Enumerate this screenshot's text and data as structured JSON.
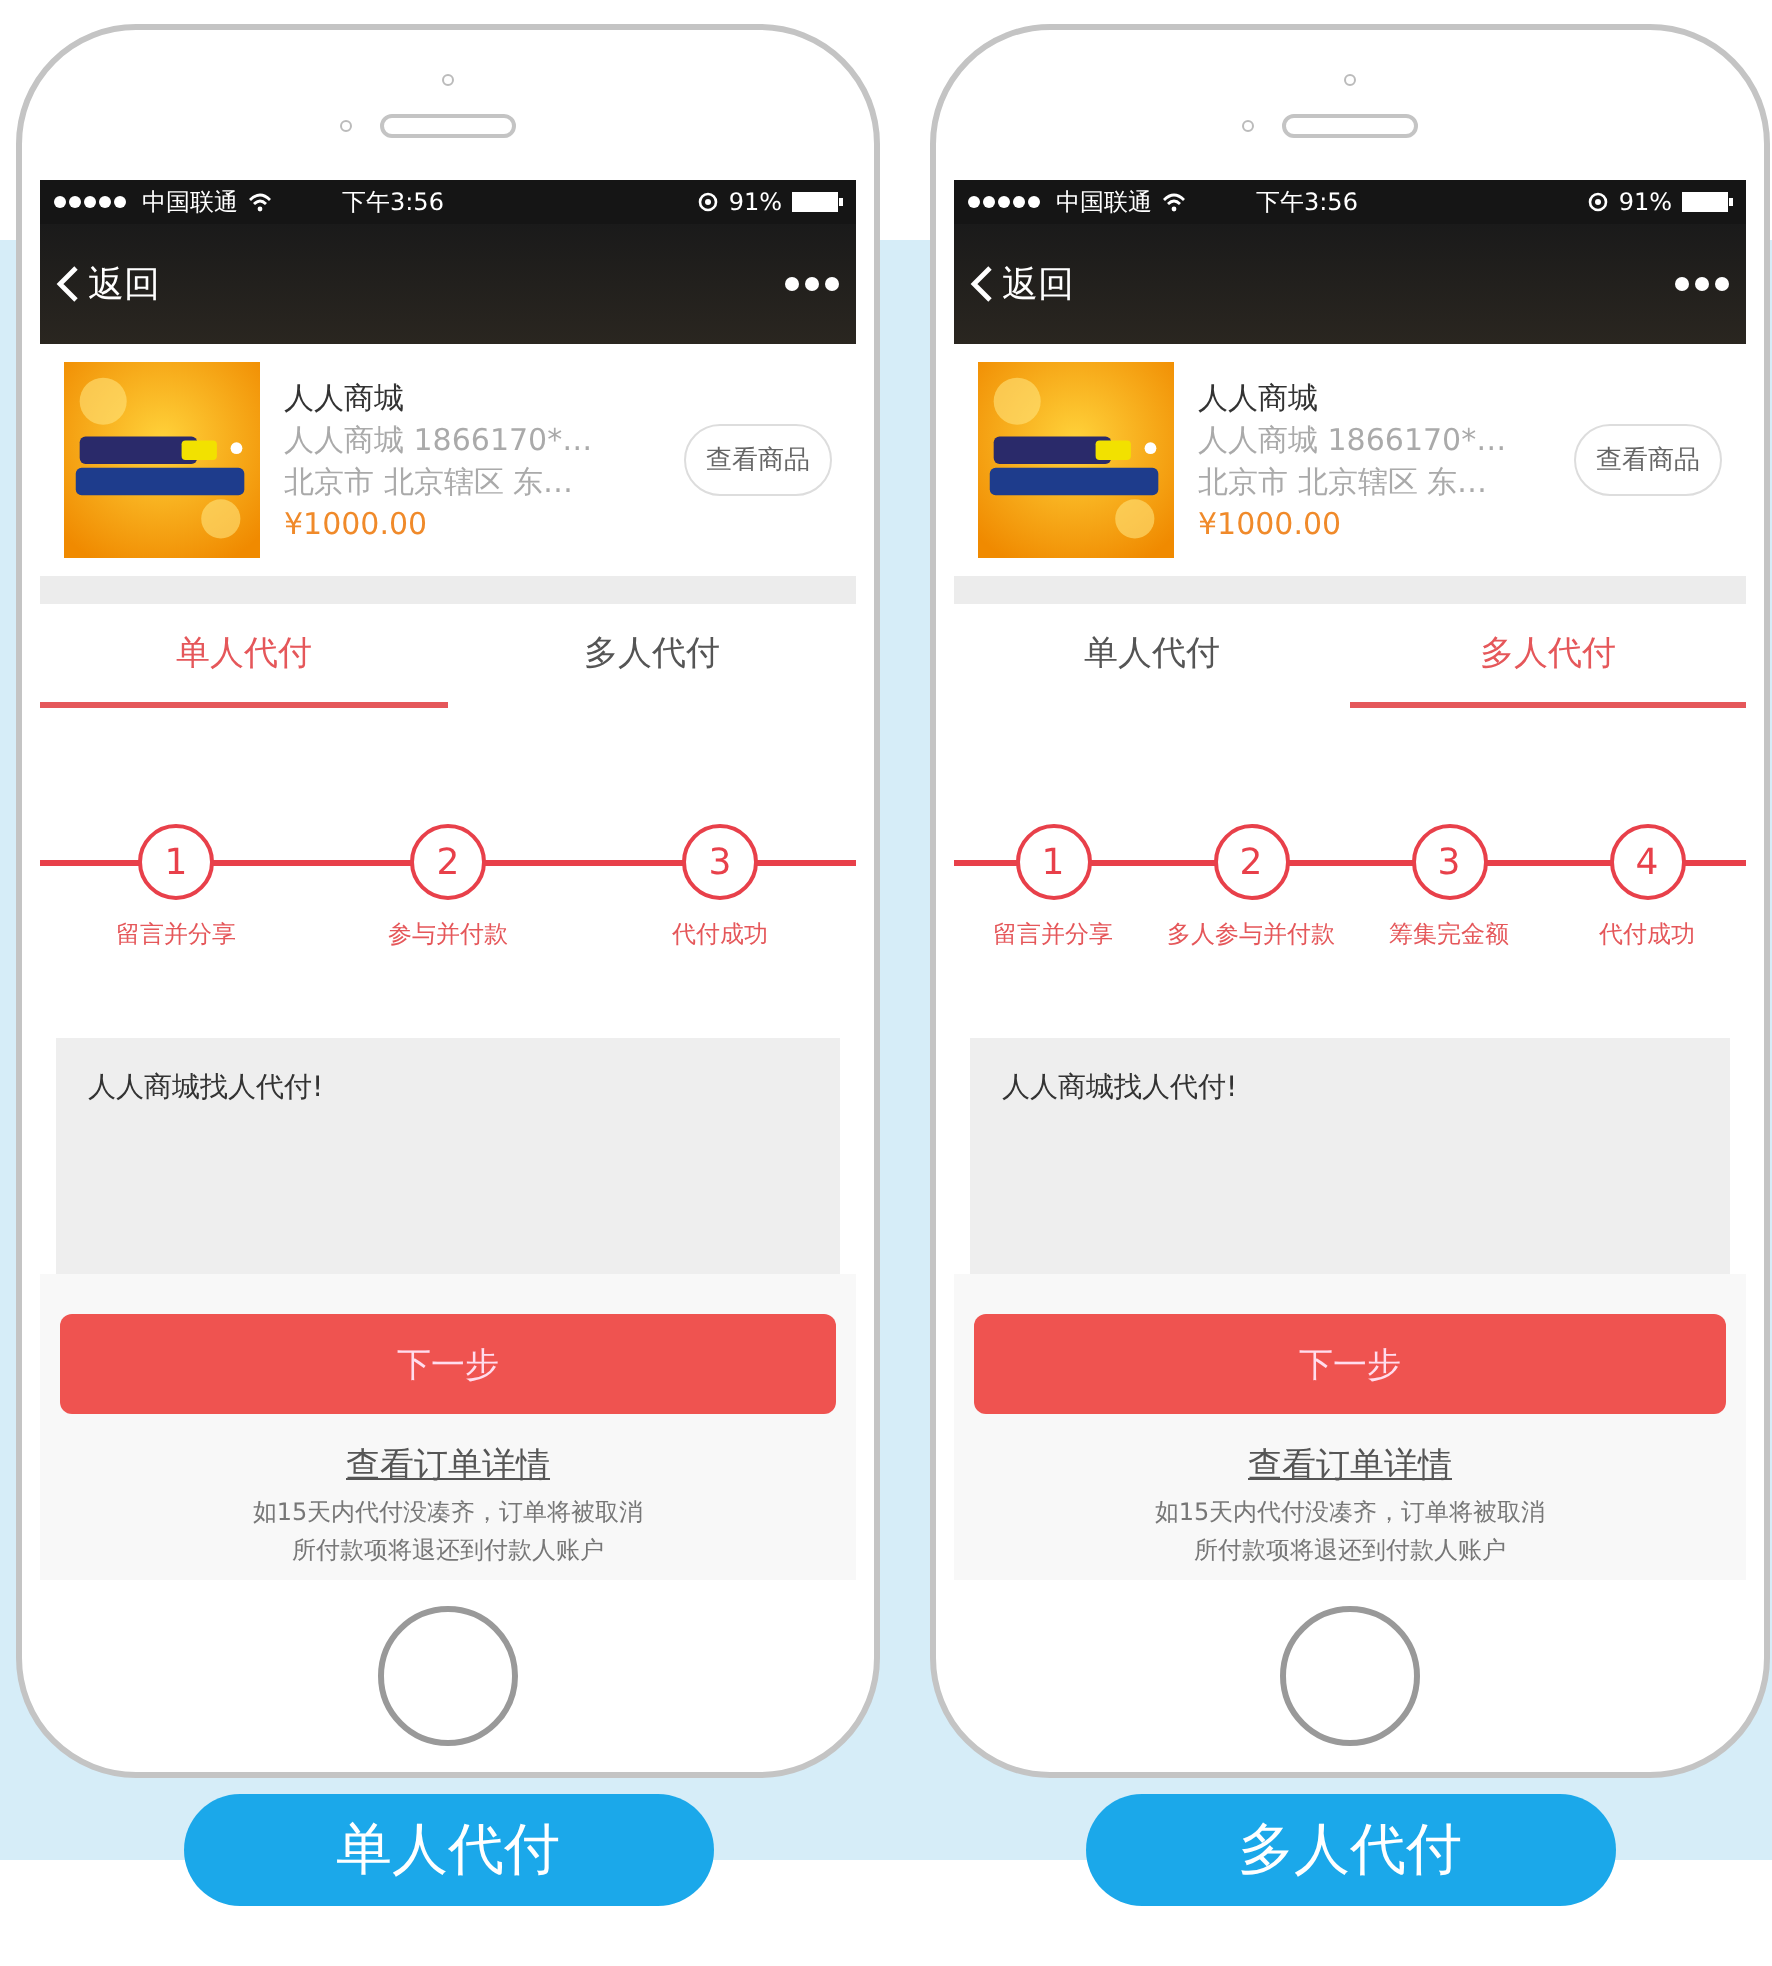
{
  "phones": [
    {
      "status_bar": {
        "carrier": "中国联通",
        "time": "下午3:56",
        "battery": "91%"
      },
      "nav": {
        "back": "返回"
      },
      "product": {
        "kind": "picture",
        "name": "人人商城",
        "line_1": "人人商城  1866170*…",
        "line_2": "北京市 北京辖区 东…",
        "price": "¥1000.00",
        "button": "查看商品"
      },
      "tabs": [
        {
          "label": "单人代付",
          "selected": true
        },
        {
          "label": "多人代付",
          "selected": false
        }
      ],
      "steps": [
        {
          "number": "1",
          "label": "留言并分享"
        },
        {
          "number": "2",
          "label": "参与并付款"
        },
        {
          "number": "3",
          "label": "代付成功"
        }
      ],
      "message": "人人商城找人代付!",
      "next_button": "下一步",
      "link": "查看订单详情",
      "notice": [
        "如15天内代付没凑齐，订单将被取消",
        "所付款项将退还到付款人账户"
      ],
      "caption": "单人代付"
    },
    {
      "status_bar": {
        "carrier": "中国联通",
        "time": "下午3:56",
        "battery": "91%"
      },
      "nav": {
        "back": "返回"
      },
      "product": {
        "kind": "picture",
        "name": "人人商城",
        "line_1": "人人商城  1866170*…",
        "line_2": "北京市 北京辖区 东…",
        "price": "¥1000.00",
        "button": "查看商品"
      },
      "tabs": [
        {
          "label": "单人代付",
          "selected": false
        },
        {
          "label": "多人代付",
          "selected": true
        }
      ],
      "steps": [
        {
          "number": "1",
          "label": "留言并分享"
        },
        {
          "number": "2",
          "label": "多人参与并付款"
        },
        {
          "number": "3",
          "label": "筹集完金额"
        },
        {
          "number": "4",
          "label": "代付成功"
        }
      ],
      "message": "人人商城找人代付!",
      "next_button": "下一步",
      "link": "查看订单详情",
      "notice": [
        "如15天内代付没凑齐，订单将被取消",
        "所付款项将退还到付款人账户"
      ],
      "caption": "多人代付"
    }
  ]
}
